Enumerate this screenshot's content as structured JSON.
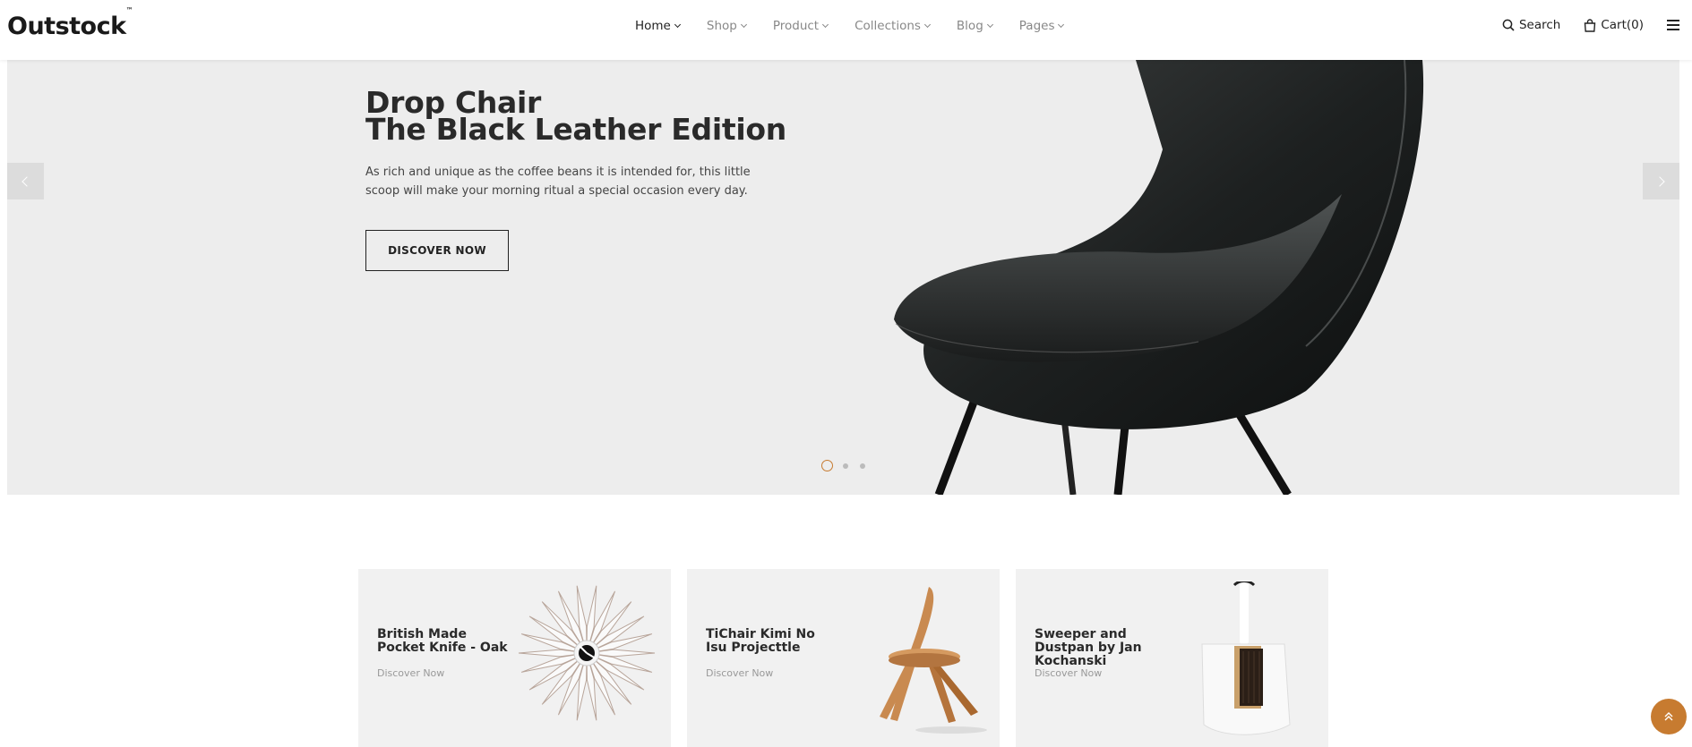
{
  "header": {
    "logo": "Outstock",
    "logo_mark": "™",
    "nav": [
      {
        "label": "Home",
        "active": true
      },
      {
        "label": "Shop",
        "active": false
      },
      {
        "label": "Product",
        "active": false
      },
      {
        "label": "Collections",
        "active": false
      },
      {
        "label": "Blog",
        "active": false
      },
      {
        "label": "Pages",
        "active": false
      }
    ],
    "search_label": "Search",
    "cart_label": "Cart(0)",
    "menu_icon": "hamburger-menu-icon"
  },
  "hero": {
    "title_line1": "Drop Chair",
    "title_line2": "The Black Leather Edition",
    "description": "As rich and unique as the coffee beans it is intended for, this little scoop will make your morning ritual a special occasion every day.",
    "button_label": "DISCOVER NOW",
    "slides": 3,
    "active_slide": 1
  },
  "cards": [
    {
      "title": "British Made Pocket Knife - Oak",
      "link": "Discover Now",
      "image": "sunburst-clock"
    },
    {
      "title": "TiChair Kimi No Isu Projecttle",
      "link": "Discover Now",
      "image": "wooden-chair"
    },
    {
      "title": "Sweeper and Dustpan by Jan Kochanski",
      "link": "Discover Now",
      "image": "dustpan-brush"
    }
  ],
  "colors": {
    "accent": "#c77b30",
    "hero_bg": "#ededed",
    "card_bg": "#f1f1f1",
    "text_dark": "#222222"
  }
}
